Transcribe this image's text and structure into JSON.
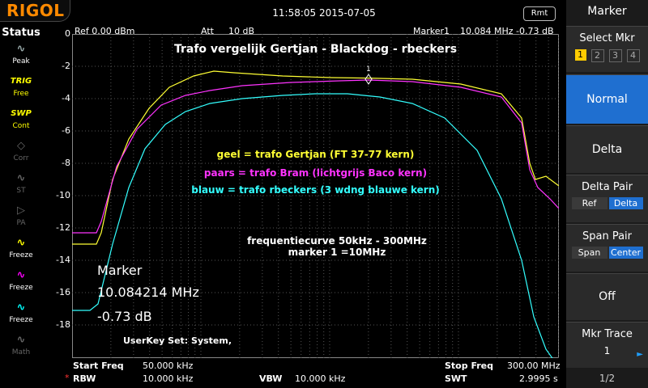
{
  "brand": "RIGOL",
  "datetime": "11:58:05 2015-07-05",
  "rmt": "Rmt",
  "status": {
    "title": "Status",
    "buttons": [
      {
        "icon": "∿",
        "label": "Peak",
        "color": "#9aa"
      },
      {
        "icon": "TRIG",
        "label": "Free",
        "color": "#ff0"
      },
      {
        "icon": "SWP",
        "label": "Cont",
        "color": "#ff0"
      },
      {
        "icon": "◇",
        "label": "Corr",
        "color": "#666"
      },
      {
        "icon": "∿",
        "label": "ST",
        "color": "#666"
      },
      {
        "icon": "▷",
        "label": "PA",
        "color": "#666"
      },
      {
        "icon": "∿",
        "label": "Freeze",
        "color": "#ff0"
      },
      {
        "icon": "∿",
        "label": "Freeze",
        "color": "#f0f"
      },
      {
        "icon": "∿",
        "label": "Freeze",
        "color": "#0ff"
      },
      {
        "icon": "∿",
        "label": "Math",
        "color": "#666"
      }
    ]
  },
  "header": {
    "ref": "Ref  0.00 dBm",
    "att_label": "Att",
    "att_value": "10 dB",
    "marker_label": "Marker1",
    "marker_value": "10.084 MHz  -0.73 dB"
  },
  "plot": {
    "title": "Trafo vergelijk Gertjan - Blackdog - rbeckers",
    "legend_yellow": "geel = trafo Gertjan (FT 37-77 kern)",
    "legend_magenta": "paars = trafo Bram (lichtgrijs Baco kern)",
    "legend_cyan": "blauw = trafo rbeckers (3 wdng blauwe kern)",
    "note1": "frequentiecurve 50kHz - 300MHz",
    "note2": "marker 1 =10MHz",
    "marker_box": {
      "title": "Marker",
      "freq": "10.084214 MHz",
      "level": "-0.73 dB"
    },
    "userkey": "UserKey Set:   System,",
    "y_labels": [
      "0",
      "-2",
      "-4",
      "-6",
      "-8",
      "-10",
      "-12",
      "-14",
      "-16",
      "-18"
    ],
    "colors": {
      "yellow": "#ffff33",
      "magenta": "#ff33ff",
      "cyan": "#33ffff",
      "grid": "#555555"
    }
  },
  "bottom": {
    "start_label": "Start Freq",
    "start_value": "50.000 kHz",
    "stop_label": "Stop Freq",
    "stop_value": "300.00 MHz",
    "rbw_label": "RBW",
    "rbw_value": "10.000 kHz",
    "vbw_label": "VBW",
    "vbw_value": "10.000 kHz",
    "swt_label": "SWT",
    "swt_value": "2.9995 s",
    "rbw_star": "*"
  },
  "menu": {
    "title": "Marker",
    "select_mkr": "Select Mkr",
    "mkr_nums": [
      "1",
      "2",
      "3",
      "4"
    ],
    "normal": "Normal",
    "delta": "Delta",
    "delta_pair": "Delta Pair",
    "ref": "Ref",
    "delta_small": "Delta",
    "span_pair": "Span Pair",
    "span": "Span",
    "center": "Center",
    "off": "Off",
    "mkr_trace": "Mkr Trace",
    "mkr_trace_value": "1",
    "page": "1/2"
  }
}
